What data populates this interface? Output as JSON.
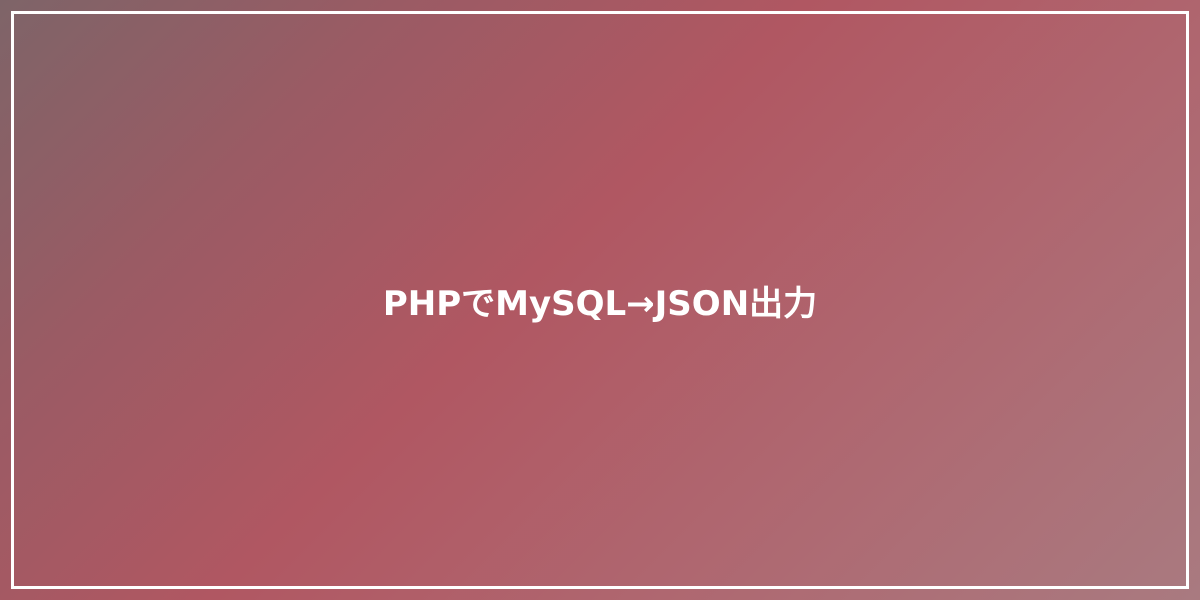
{
  "card": {
    "title": "PHPでMySQL→JSON出力"
  },
  "colors": {
    "gradient_start": "#7e6468",
    "gradient_mid": "#b05762",
    "gradient_end": "#a97a80",
    "frame": "#ffffff",
    "text": "#ffffff"
  }
}
